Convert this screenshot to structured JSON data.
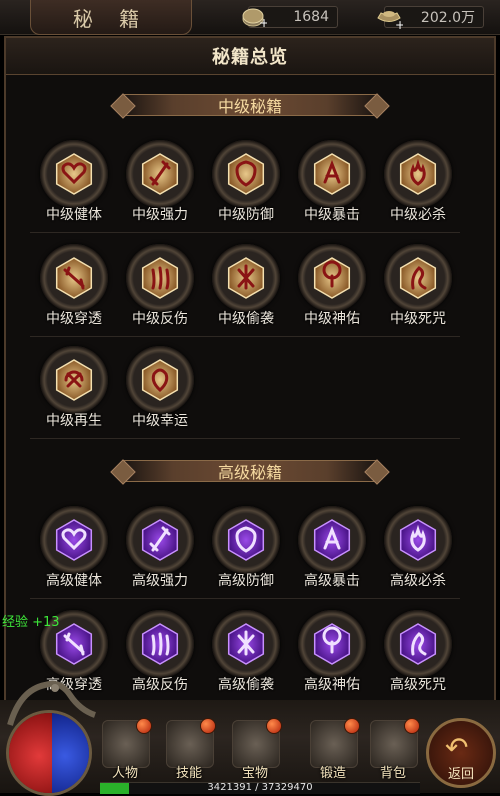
{
  "top_bar": {
    "title": "秘 籍",
    "gold_amount": "1684",
    "yuanbao_amount": "202.0万",
    "gold_icon": "coin-icon",
    "yuanbao_icon": "ingot-icon"
  },
  "panel": {
    "title": "秘籍总览"
  },
  "sections": [
    {
      "title": "中级秘籍",
      "color": "#c89a4a",
      "skills": [
        {
          "label": "中级健体",
          "icon": "heart-icon"
        },
        {
          "label": "中级强力",
          "icon": "sword-icon"
        },
        {
          "label": "中级防御",
          "icon": "shield-icon"
        },
        {
          "label": "中级暴击",
          "icon": "crit-icon"
        },
        {
          "label": "中级必杀",
          "icon": "flame-icon"
        },
        {
          "label": "中级穿透",
          "icon": "pierce-icon"
        },
        {
          "label": "中级反伤",
          "icon": "claw-icon"
        },
        {
          "label": "中级偷袭",
          "icon": "strike-icon"
        },
        {
          "label": "中级神佑",
          "icon": "halo-icon"
        },
        {
          "label": "中级死咒",
          "icon": "curse-icon"
        },
        {
          "label": "中级再生",
          "icon": "regen-icon"
        },
        {
          "label": "中级幸运",
          "icon": "luck-icon"
        }
      ]
    },
    {
      "title": "高级秘籍",
      "color": "#8a3ad8",
      "skills": [
        {
          "label": "高级健体",
          "icon": "heart-icon"
        },
        {
          "label": "高级强力",
          "icon": "sword-icon"
        },
        {
          "label": "高级防御",
          "icon": "shield-icon"
        },
        {
          "label": "高级暴击",
          "icon": "crit-icon"
        },
        {
          "label": "高级必杀",
          "icon": "flame-icon"
        },
        {
          "label": "高级穿透",
          "icon": "pierce-icon"
        },
        {
          "label": "高级反伤",
          "icon": "claw-icon"
        },
        {
          "label": "高级偷袭",
          "icon": "strike-icon"
        },
        {
          "label": "高级神佑",
          "icon": "halo-icon"
        },
        {
          "label": "高级死咒",
          "icon": "curse-icon"
        }
      ]
    }
  ],
  "floating_text": "经验 +13",
  "bottom_menu": [
    {
      "label": "人物",
      "icon": "helmet-icon"
    },
    {
      "label": "技能",
      "icon": "scroll-icon"
    },
    {
      "label": "宝物",
      "icon": "treasure-icon"
    },
    {
      "label": "锻造",
      "icon": "anvil-icon"
    },
    {
      "label": "背包",
      "icon": "bag-icon"
    }
  ],
  "return_button": {
    "label": "返回",
    "icon": "return-arrow-icon"
  },
  "experience": {
    "text": "3421391 / 37329470",
    "fraction": 0.0917
  }
}
